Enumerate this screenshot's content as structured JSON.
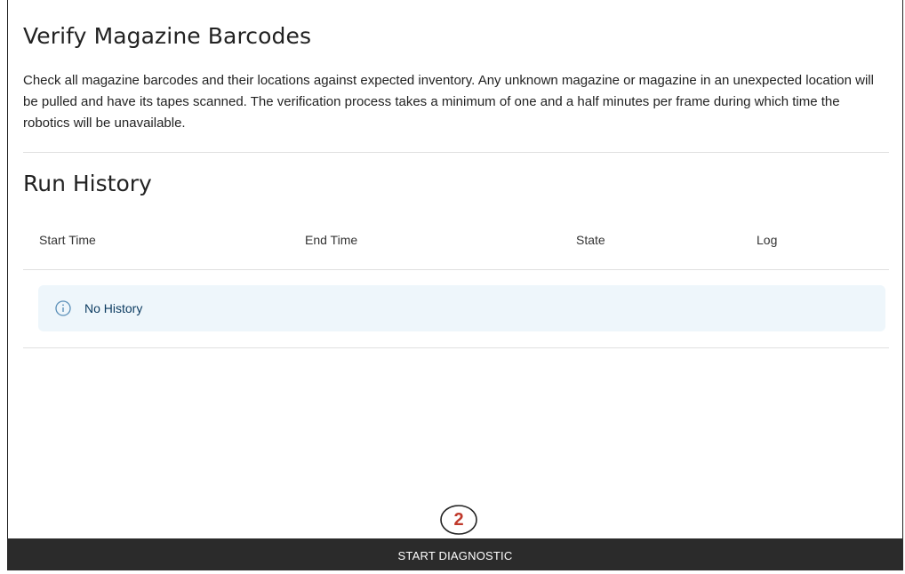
{
  "page": {
    "title": "Verify Magazine Barcodes",
    "description": "Check all magazine barcodes and their locations against expected inventory. Any unknown magazine or magazine in an unexpected location will be pulled and have its tapes scanned. The verification process takes a minimum of one and a half minutes per frame during which time the robotics will be unavailable."
  },
  "run_history": {
    "title": "Run History",
    "columns": [
      "Start Time",
      "End Time",
      "State",
      "Log"
    ],
    "empty_icon": "info-circle-icon",
    "empty_message": "No History"
  },
  "annotation": {
    "step_number": "2",
    "color": "#c0392b"
  },
  "footer": {
    "start_label": "START DIAGNOSTIC",
    "background": "#2b2b2b"
  }
}
